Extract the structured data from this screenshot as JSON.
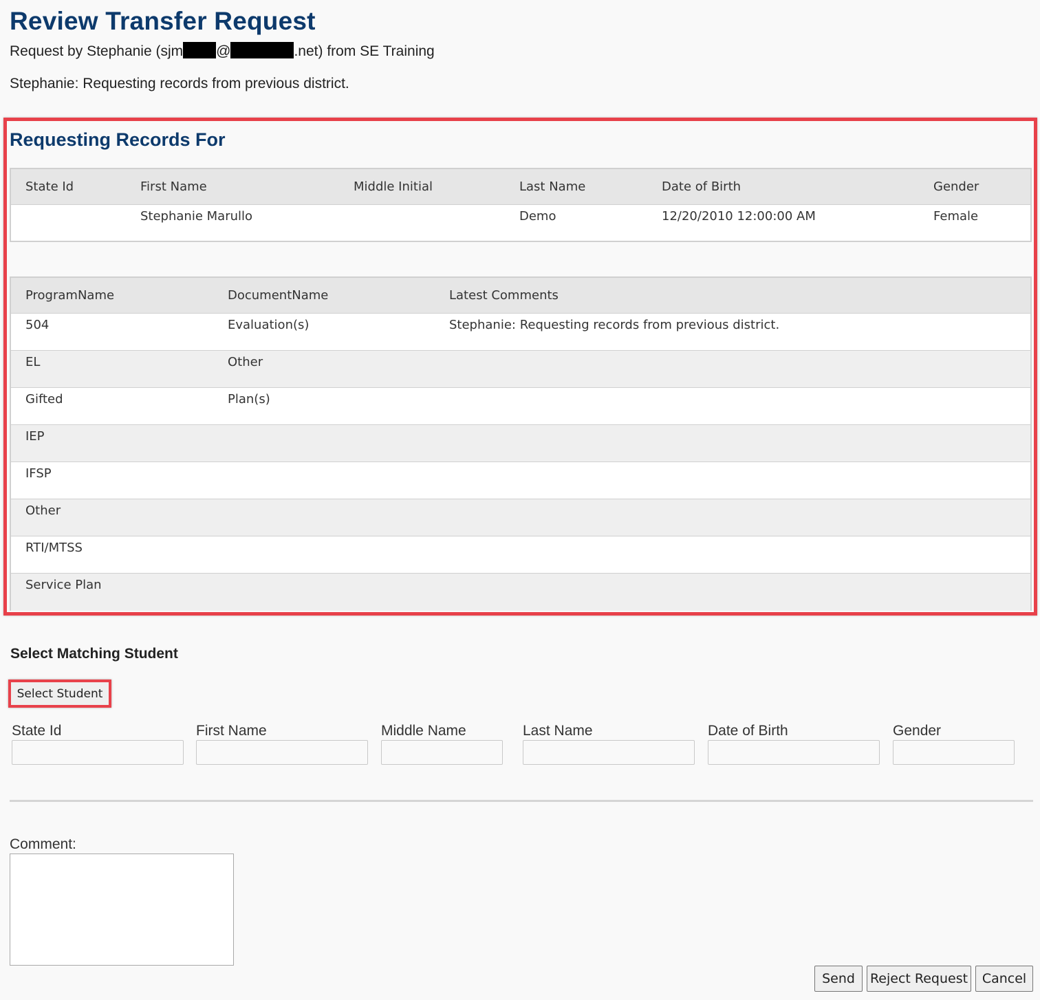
{
  "header": {
    "title": "Review Transfer Request",
    "request_prefix": "Request by Stephanie (sjm",
    "at_sign": "@",
    "request_suffix": ".net) from SE Training",
    "comment": "Stephanie: Requesting records from previous district."
  },
  "records": {
    "title": "Requesting Records For",
    "student_columns": [
      "State Id",
      "First Name",
      "Middle Initial",
      "Last Name",
      "Date of Birth",
      "Gender"
    ],
    "student": {
      "state_id": "",
      "first_name": "Stephanie Marullo",
      "middle_initial": "",
      "last_name": "Demo",
      "date_of_birth": "12/20/2010 12:00:00 AM",
      "gender": "Female"
    },
    "program_columns": [
      "ProgramName",
      "DocumentName",
      "Latest Comments"
    ],
    "programs": [
      {
        "program": "504",
        "document": "Evaluation(s)",
        "comments": "Stephanie: Requesting records from previous district."
      },
      {
        "program": "EL",
        "document": "Other",
        "comments": ""
      },
      {
        "program": "Gifted",
        "document": "Plan(s)",
        "comments": ""
      },
      {
        "program": "IEP",
        "document": "",
        "comments": ""
      },
      {
        "program": "IFSP",
        "document": "",
        "comments": ""
      },
      {
        "program": "Other",
        "document": "",
        "comments": ""
      },
      {
        "program": "RTI/MTSS",
        "document": "",
        "comments": ""
      },
      {
        "program": "Service Plan",
        "document": "",
        "comments": ""
      }
    ]
  },
  "match": {
    "heading": "Select Matching Student",
    "select_button": "Select Student",
    "fields": [
      {
        "label": "State Id",
        "value": ""
      },
      {
        "label": "First Name",
        "value": ""
      },
      {
        "label": "Middle Name",
        "value": ""
      },
      {
        "label": "Last Name",
        "value": ""
      },
      {
        "label": "Date of Birth",
        "value": ""
      },
      {
        "label": "Gender",
        "value": ""
      }
    ]
  },
  "comment": {
    "label": "Comment:",
    "value": ""
  },
  "actions": {
    "send": "Send",
    "reject": "Reject Request",
    "cancel": "Cancel"
  },
  "colors": {
    "title_blue": "#0d3a6c",
    "highlight_red": "#e8414a",
    "header_row_gray": "#e6e6e6"
  }
}
